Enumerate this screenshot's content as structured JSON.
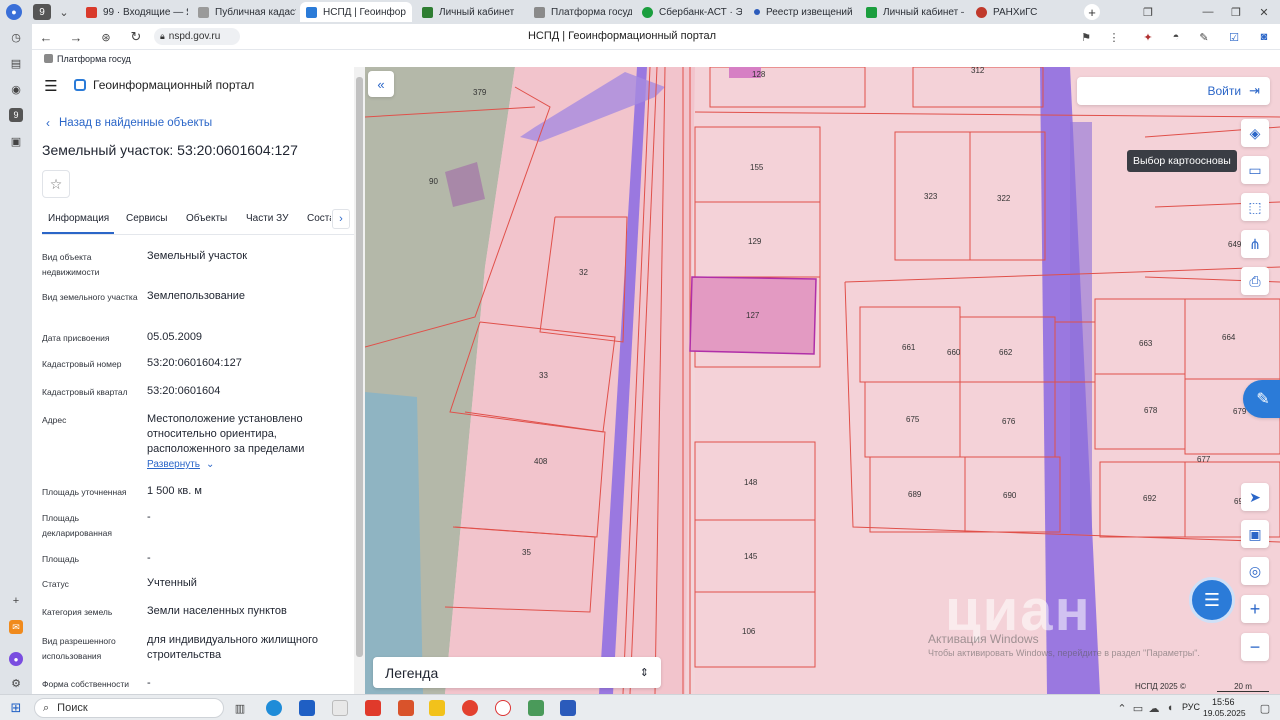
{
  "browser": {
    "tab_count": "9",
    "tabs": [
      {
        "label": "99 · Входящие — Ян",
        "color": "#d93a2b"
      },
      {
        "label": "Публичная кадастр",
        "color": "#7a7a7a"
      },
      {
        "label": "НСПД | Геоинфор",
        "color": "#2b7bd8"
      },
      {
        "label": "Личный кабинет",
        "color": "#2e7d32"
      },
      {
        "label": "Платформа государ",
        "color": "#7a7a7a"
      },
      {
        "label": "Сбербанк-АСТ · Эл",
        "color": "#1b9e3e"
      },
      {
        "label": "Реестр извещений",
        "color": "#2b5bbb"
      },
      {
        "label": "Личный кабинет —",
        "color": "#1b9e3e"
      },
      {
        "label": "РАНХиГС",
        "color": "#c0392b"
      }
    ],
    "url": "nspd.gov.ru",
    "page_title": "НСПД | Геоинформационный портал",
    "bookmark": "Платформа госуд"
  },
  "portal": {
    "title": "Геоинформационный портал",
    "back_link": "Назад в найденные объекты",
    "object_title": "Земельный участок: 53:20:0601604:127",
    "tabs": [
      "Информация",
      "Сервисы",
      "Объекты",
      "Части ЗУ",
      "Соста"
    ],
    "expand_label": "Развернуть",
    "properties": [
      {
        "label": "Вид объекта недвижимости",
        "value": "Земельный участок"
      },
      {
        "label": "Вид земельного участка",
        "value": "Землепользование"
      },
      {
        "label": "Дата присвоения",
        "value": "05.05.2009"
      },
      {
        "label": "Кадастровый номер",
        "value": "53:20:0601604:127"
      },
      {
        "label": "Кадастровый квартал",
        "value": "53:20:0601604"
      },
      {
        "label": "Адрес",
        "value": "Местоположение установлено относительно ориентира, расположенного за пределами"
      },
      {
        "label": "Площадь уточненная",
        "value": "1 500 кв. м"
      },
      {
        "label": "Площадь декларированная",
        "value": "-"
      },
      {
        "label": "Площадь",
        "value": "-"
      },
      {
        "label": "Статус",
        "value": "Учтенный"
      },
      {
        "label": "Категория земель",
        "value": "Земли населенных пунктов"
      },
      {
        "label": "Вид разрешенного использования",
        "value": "для индивидуального жилищного строительства"
      },
      {
        "label": "Форма собственности",
        "value": "-"
      }
    ]
  },
  "map": {
    "login_label": "Войти",
    "tooltip": "Выбор картоосновы",
    "legend_label": "Легенда",
    "watermark_brand": "циан",
    "watermark_activation_title": "Активация Windows",
    "watermark_activation_text": "Чтобы активировать Windows, перейдите в раздел \"Параметры\".",
    "copyright": "НСПД 2025 ©",
    "scale": "20 m",
    "parcels": [
      "379",
      "128",
      "312",
      "90",
      "155",
      "323",
      "322",
      "649",
      "32",
      "129",
      "127",
      "661",
      "660",
      "662",
      "663",
      "664",
      "33",
      "675",
      "676",
      "678",
      "679",
      "408",
      "677",
      "148",
      "689",
      "690",
      "692",
      "693",
      "35",
      "145",
      "106"
    ]
  },
  "taskbar": {
    "search_label": "Поиск",
    "language": "РУС",
    "time": "15:56",
    "date": "19.05.2025"
  }
}
